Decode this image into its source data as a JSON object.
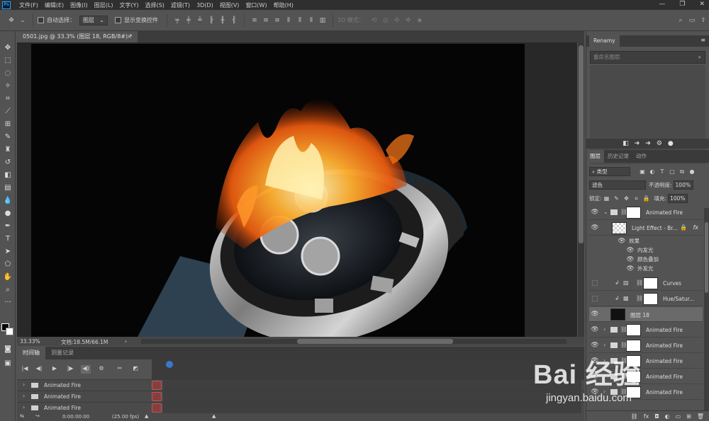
{
  "app": {
    "logo": "Ps"
  },
  "menu": [
    "文件(F)",
    "编辑(E)",
    "图像(I)",
    "图层(L)",
    "文字(Y)",
    "选择(S)",
    "滤镜(T)",
    "3D(D)",
    "视图(V)",
    "窗口(W)",
    "帮助(H)"
  ],
  "options": {
    "auto_select_label": "自动选择：",
    "auto_select_value": "图层",
    "show_transform_label": "显示变换控件",
    "mode_3d_label": "3D 模式："
  },
  "document": {
    "tab_title": "0501.jpg @ 33.3% (图层 18, RGB/8#) *",
    "close": "×",
    "zoom": "33.33%",
    "doc_size": "文档:18.5M/66.1M"
  },
  "timeline": {
    "tabs": [
      "时间轴",
      "测量记录"
    ],
    "tracks": [
      "Animated Fire",
      "Animated Fire",
      "Animated Fire"
    ],
    "timecode": "0:00:00:00",
    "fps": "(25.00 fps)"
  },
  "renamy": {
    "tab": "Renamy",
    "search_placeholder": "重命名图层"
  },
  "layers_panel": {
    "tabs": [
      "图层",
      "历史记录",
      "动作"
    ],
    "filter_kind": "类型",
    "blend_mode": "滤色",
    "opacity_label": "不透明度:",
    "opacity_value": "100%",
    "lock_label": "锁定:",
    "fill_label": "填充:",
    "fill_value": "100%",
    "layers": [
      {
        "name": "Animated Fire",
        "kind": "group",
        "visible": true
      },
      {
        "name": "Light Effect - Br...",
        "kind": "smart",
        "visible": true,
        "fx": "fx"
      },
      {
        "name": "效果",
        "kind": "effects",
        "visible": true
      },
      {
        "name": "内发光",
        "kind": "effect",
        "visible": true
      },
      {
        "name": "颜色叠加",
        "kind": "effect",
        "visible": true
      },
      {
        "name": "外发光",
        "kind": "effect",
        "visible": true
      },
      {
        "name": "Curves",
        "kind": "adjustment",
        "visible": false
      },
      {
        "name": "Hue/Satur...",
        "kind": "adjustment",
        "visible": false
      },
      {
        "name": "图层 18",
        "kind": "pixel",
        "visible": true,
        "selected": true
      },
      {
        "name": "Animated Fire",
        "kind": "group",
        "visible": true
      },
      {
        "name": "Animated Fire",
        "kind": "group",
        "visible": true
      },
      {
        "name": "Animated Fire",
        "kind": "group",
        "visible": true
      },
      {
        "name": "Animated Fire",
        "kind": "group",
        "visible": true
      },
      {
        "name": "Animated Fire",
        "kind": "group",
        "visible": true
      }
    ]
  },
  "watermark": {
    "logo": "Bai 经验",
    "url": "jingyan.baidu.com"
  }
}
